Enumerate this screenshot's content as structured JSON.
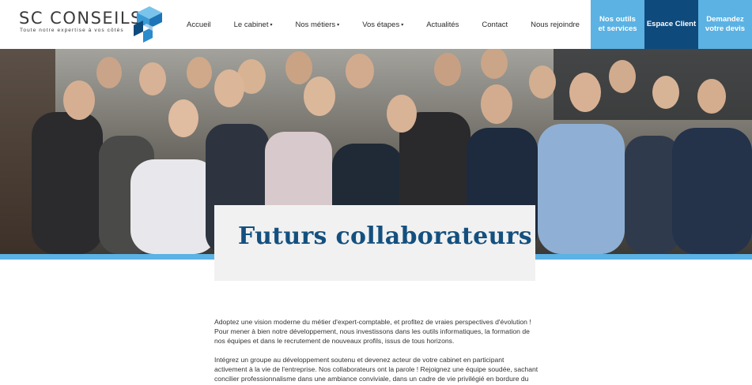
{
  "header": {
    "logo": {
      "name": "SC CONSEILS",
      "tagline": "Toute notre expertise à vos côtés"
    },
    "nav": [
      {
        "label": "Accueil",
        "has_dropdown": false
      },
      {
        "label": "Le cabinet",
        "has_dropdown": true
      },
      {
        "label": "Nos métiers",
        "has_dropdown": true
      },
      {
        "label": "Vos étapes",
        "has_dropdown": true
      },
      {
        "label": "Actualités",
        "has_dropdown": false
      },
      {
        "label": "Contact",
        "has_dropdown": false
      },
      {
        "label": "Nous rejoindre",
        "has_dropdown": false
      }
    ],
    "cta": {
      "tools_line1": "Nos outils",
      "tools_line2": "et services",
      "client": "Espace Client",
      "quote_line1": "Demandez",
      "quote_line2": "votre devis"
    },
    "caret": "▾"
  },
  "hero": {
    "image": "team-group-photo"
  },
  "page": {
    "title": "Futurs collaborateurs"
  },
  "content": {
    "paragraphs": [
      "Adoptez une vision moderne du métier d'expert-comptable, et profitez de vraies perspectives d'évolution ! Pour mener à bien notre développement, nous investissons dans les outils informatiques, la formation de nos équipes et dans le recrutement de nouveaux profils, issus de tous horizons.",
      "Intégrez un groupe au développement soutenu et devenez acteur de votre cabinet en participant activement à la vie de l'entreprise. Nos collaborateurs ont la parole ! Rejoignez une équipe soudée, sachant concilier professionnalisme dans une ambiance conviviale, dans un cadre de vie privilégié en bordure du"
    ]
  },
  "colors": {
    "accent_light": "#5bb2e3",
    "accent_dark": "#0f4a7d",
    "title": "#14507f"
  }
}
